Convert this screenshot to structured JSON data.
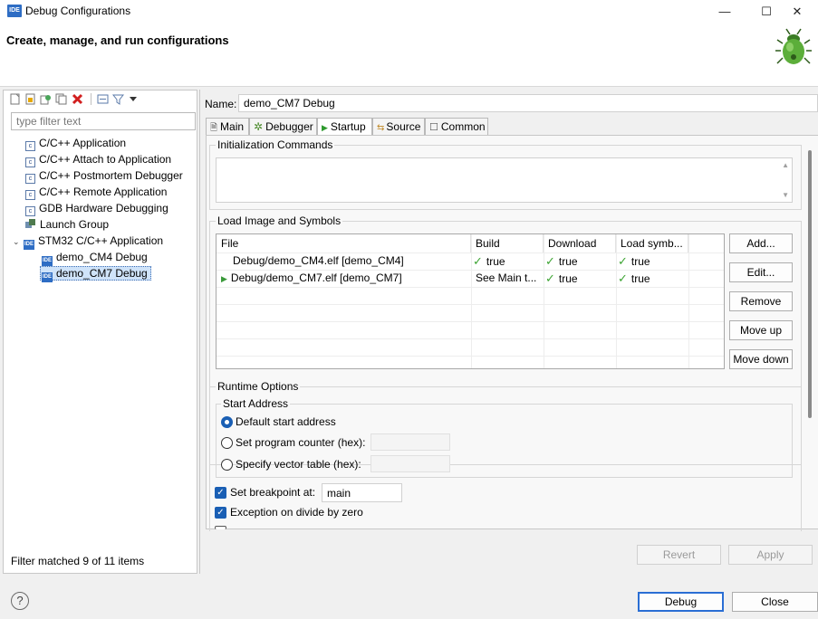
{
  "window": {
    "app_icon_text": "IDE",
    "title": "Debug Configurations",
    "minimize_glyph": "—",
    "maximize_glyph": "☐",
    "close_glyph": "✕"
  },
  "header": {
    "title": "Create, manage, and run configurations",
    "icon": "bug-icon"
  },
  "left": {
    "filter_placeholder": "type filter text",
    "tree": [
      {
        "label": "C/C++ Application",
        "icon": "c-config-icon"
      },
      {
        "label": "C/C++ Attach to Application",
        "icon": "c-config-icon"
      },
      {
        "label": "C/C++ Postmortem Debugger",
        "icon": "c-config-icon"
      },
      {
        "label": "C/C++ Remote Application",
        "icon": "c-config-icon"
      },
      {
        "label": "GDB Hardware Debugging",
        "icon": "c-config-icon"
      },
      {
        "label": "Launch Group",
        "icon": "launch-group-icon"
      },
      {
        "label": "STM32 C/C++ Application",
        "icon": "ide-icon",
        "expanded": true,
        "children": [
          {
            "label": "demo_CM4 Debug",
            "icon": "ide-icon"
          },
          {
            "label": "demo_CM7 Debug",
            "icon": "ide-icon",
            "selected": true
          }
        ]
      }
    ],
    "status": "Filter matched 9 of 11 items"
  },
  "right": {
    "name_label": "Name:",
    "name_value": "demo_CM7 Debug",
    "tabs": [
      "Main",
      "Debugger",
      "Startup",
      "Source",
      "Common"
    ],
    "active_tab": "Startup",
    "init_commands_title": "Initialization Commands",
    "load_image_title": "Load Image and Symbols",
    "table": {
      "headers": [
        "File",
        "Build",
        "Download",
        "Load symb..."
      ],
      "rows": [
        {
          "file": "Debug/demo_CM4.elf [demo_CM4]",
          "build": "true",
          "download": "true",
          "load": "true",
          "arrow": false
        },
        {
          "file": "Debug/demo_CM7.elf [demo_CM7]",
          "build": "See Main t...",
          "download": "true",
          "load": "true",
          "arrow": true
        }
      ]
    },
    "table_buttons": [
      "Add...",
      "Edit...",
      "Remove",
      "Move up",
      "Move down"
    ],
    "runtime_title": "Runtime Options",
    "start_address_title": "Start Address",
    "radios": [
      {
        "label": "Default start address",
        "checked": true
      },
      {
        "label": "Set program counter (hex):",
        "checked": false
      },
      {
        "label": "Specify vector table (hex):",
        "checked": false
      }
    ],
    "set_breakpoint_label": "Set breakpoint at:",
    "set_breakpoint_checked": true,
    "breakpoint_value": "main",
    "exception_divide_label": "Exception on divide by zero",
    "exception_divide_checked": true,
    "revert_label": "Revert",
    "apply_label": "Apply"
  },
  "footer": {
    "help_glyph": "?",
    "debug_label": "Debug",
    "close_label": "Close"
  }
}
